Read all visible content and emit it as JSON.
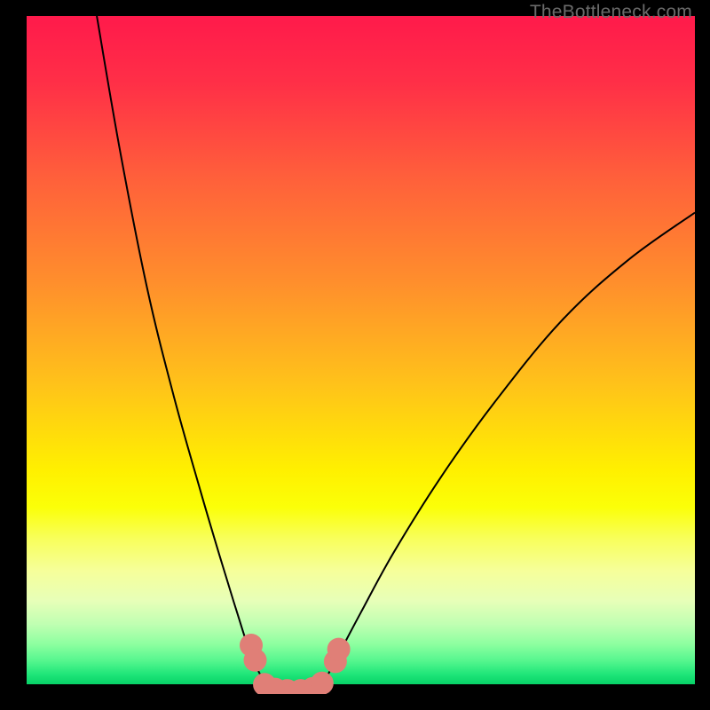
{
  "watermark": "TheBottleneck.com",
  "colors": {
    "frame": "#000000",
    "curve": "#000000",
    "marker": "#e07f77",
    "gradient_stops": [
      {
        "offset": 0.0,
        "color": "#ff1a4b"
      },
      {
        "offset": 0.1,
        "color": "#ff2f47"
      },
      {
        "offset": 0.24,
        "color": "#ff5f3b"
      },
      {
        "offset": 0.4,
        "color": "#ff8f2c"
      },
      {
        "offset": 0.55,
        "color": "#ffc21a"
      },
      {
        "offset": 0.68,
        "color": "#fff000"
      },
      {
        "offset": 0.735,
        "color": "#fbff08"
      },
      {
        "offset": 0.78,
        "color": "#f8ff58"
      },
      {
        "offset": 0.83,
        "color": "#f6ff9a"
      },
      {
        "offset": 0.875,
        "color": "#e7ffb8"
      },
      {
        "offset": 0.91,
        "color": "#c0ffb2"
      },
      {
        "offset": 0.94,
        "color": "#8dffa0"
      },
      {
        "offset": 0.965,
        "color": "#55f68e"
      },
      {
        "offset": 0.985,
        "color": "#1fe679"
      },
      {
        "offset": 1.0,
        "color": "#07d267"
      }
    ]
  },
  "chart_data": {
    "type": "line",
    "title": "",
    "xlabel": "",
    "ylabel": "",
    "x_range": [
      0,
      100
    ],
    "y_range": [
      0,
      100
    ],
    "curve_points": [
      {
        "x": 10.5,
        "y": 100
      },
      {
        "x": 14,
        "y": 80
      },
      {
        "x": 18,
        "y": 60
      },
      {
        "x": 22,
        "y": 44
      },
      {
        "x": 26,
        "y": 30
      },
      {
        "x": 29,
        "y": 20
      },
      {
        "x": 31.5,
        "y": 12
      },
      {
        "x": 33.5,
        "y": 6
      },
      {
        "x": 35.5,
        "y": 2
      },
      {
        "x": 37.5,
        "y": 0.4
      },
      {
        "x": 40,
        "y": 0.1
      },
      {
        "x": 42.5,
        "y": 0.4
      },
      {
        "x": 44.5,
        "y": 2
      },
      {
        "x": 46.5,
        "y": 5.5
      },
      {
        "x": 50,
        "y": 12
      },
      {
        "x": 55,
        "y": 21
      },
      {
        "x": 62,
        "y": 32
      },
      {
        "x": 70,
        "y": 43
      },
      {
        "x": 80,
        "y": 55
      },
      {
        "x": 90,
        "y": 64
      },
      {
        "x": 100,
        "y": 71
      }
    ],
    "markers": [
      {
        "x": 33.6,
        "y": 7.2
      },
      {
        "x": 34.2,
        "y": 5.0
      },
      {
        "x": 35.6,
        "y": 1.4
      },
      {
        "x": 37.2,
        "y": 0.7
      },
      {
        "x": 39.0,
        "y": 0.5
      },
      {
        "x": 41.0,
        "y": 0.5
      },
      {
        "x": 42.8,
        "y": 0.8
      },
      {
        "x": 44.2,
        "y": 1.6
      },
      {
        "x": 46.2,
        "y": 4.8
      },
      {
        "x": 46.7,
        "y": 6.6
      }
    ]
  }
}
